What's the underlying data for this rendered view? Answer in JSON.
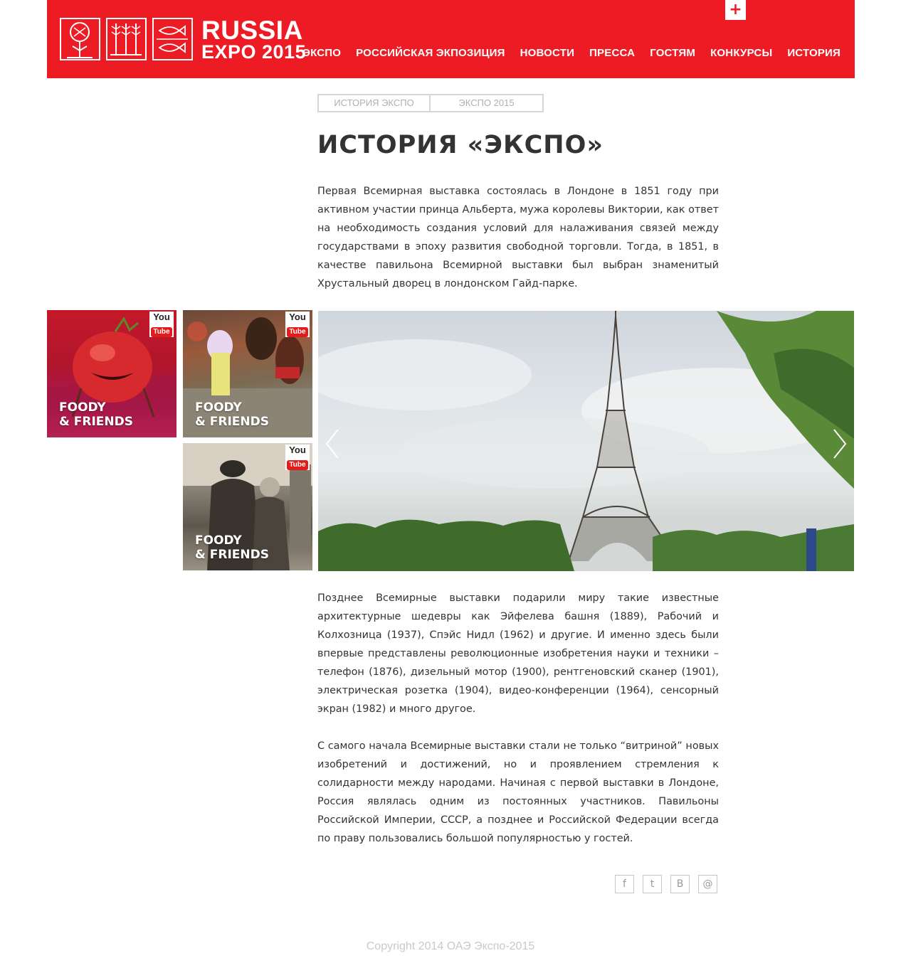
{
  "header": {
    "logo_line1": "RUSSIA",
    "logo_line2": "EXPO 2015",
    "plus_label": "+",
    "nav": [
      "ЭКСПО",
      "РОССИЙСКАЯ ЭКПОЗИЦИЯ",
      "НОВОСТИ",
      "ПРЕССА",
      "ГОСТЯМ",
      "КОНКУРСЫ",
      "ИСТОРИЯ"
    ]
  },
  "tabs": [
    "ИСТОРИЯ ЭКСПО",
    "ЭКСПО 2015"
  ],
  "title": "ИСТОРИЯ «ЭКСПО»",
  "paragraphs": [
    "Первая Всемирная выставка состоялась в Лондоне в 1851 году при активном участии принца Альберта, мужа королевы Виктории, как ответ на необходимость создания условий для налаживания связей между государствами в эпоху развития свободной торговли. Тогда, в 1851, в качестве павильона Всемирной выставки был выбран знаменитый Хрустальный дворец в лондонском Гайд-парке.",
    "Позднее Всемирные выставки подарили миру такие известные архитектурные шедевры как Эйфелева башня (1889), Рабочий и Колхозница (1937), Спэйс Нидл (1962) и другие. И именно здесь были впервые представлены революционные изобретения науки и техники – телефон (1876), дизельный мотор (1900), рентгеновский сканер (1901), электрическая розетка (1904), видео-конференции (1964), сенсорный экран (1982) и много другое.",
    "С самого начала Всемирные выставки стали не только “витриной” новых изобретений и достижений, но и проявлением стремления к солидарности между народами. Начиная с первой выставки в Лондоне, Россия являлась одним из постоянных участников. Павильоны Российской Империи, СССР, а позднее и Российской Федерации всегда по праву пользовались большой популярностью у гостей."
  ],
  "videos": [
    {
      "line1": "FOODY",
      "line2": "& FRIENDS",
      "badge_you": "You",
      "badge_tube": "Tube"
    },
    {
      "line1": "FOODY",
      "line2": "& FRIENDS",
      "badge_you": "You",
      "badge_tube": "Tube"
    },
    {
      "line1": "FOODY",
      "line2": "& FRIENDS",
      "badge_you": "You",
      "badge_tube": "Tube"
    }
  ],
  "slider": {
    "image": "eiffel-tower-photo"
  },
  "share": [
    {
      "icon": "facebook-icon",
      "glyph": "f"
    },
    {
      "icon": "twitter-icon",
      "glyph": "t"
    },
    {
      "icon": "vk-icon",
      "glyph": "B"
    },
    {
      "icon": "mail-icon",
      "glyph": "@"
    }
  ],
  "colors": {
    "brand": "#ed1c24"
  },
  "footer": {
    "copyright": "Copyright 2014 ОАЭ Экспо-2015"
  }
}
